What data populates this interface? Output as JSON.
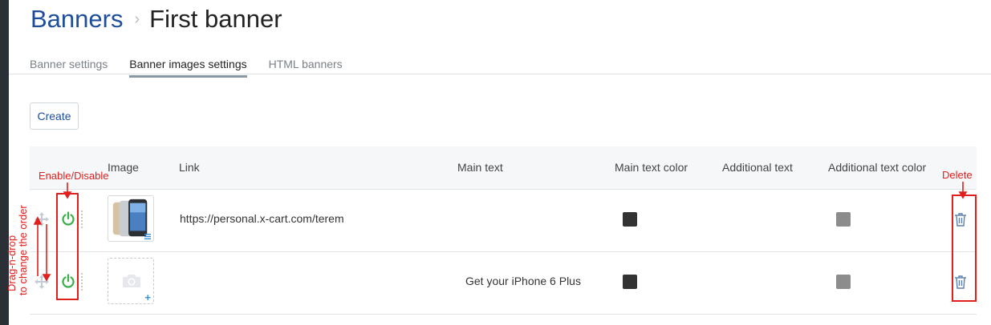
{
  "breadcrumb": {
    "parent": "Banners",
    "separator": "›",
    "current": "First banner"
  },
  "tabs": [
    {
      "label": "Banner settings",
      "active": false
    },
    {
      "label": "Banner images settings",
      "active": true
    },
    {
      "label": "HTML banners",
      "active": false
    }
  ],
  "toolbar": {
    "create_label": "Create"
  },
  "table": {
    "headers": {
      "image": "Image",
      "link": "Link",
      "main_text": "Main text",
      "main_text_color": "Main text color",
      "additional_text": "Additional text",
      "additional_text_color": "Additional text color"
    },
    "rows": [
      {
        "enabled": true,
        "image": "iphone",
        "link": "https://personal.x-cart.com/terem",
        "main_text": "",
        "main_text_color": "#333333",
        "additional_text": "",
        "additional_text_color": "#8c8c8c"
      },
      {
        "enabled": true,
        "image": "",
        "link": "",
        "main_text": "Get your iPhone 6 Plus",
        "main_text_color": "#333333",
        "additional_text": "",
        "additional_text_color": "#8c8c8c"
      }
    ]
  },
  "annotations": {
    "enable_disable": "Enable/Disable",
    "delete": "Delete",
    "drag_line1": "Drag-n-drop",
    "drag_line2": "to change the order"
  },
  "icons": {
    "move": "move-icon",
    "power": "power-icon",
    "trash": "trash-icon",
    "camera": "camera-icon"
  },
  "colors": {
    "brand": "#1d4d9b",
    "enabled": "#3aae48",
    "annotation": "#e0201f"
  }
}
